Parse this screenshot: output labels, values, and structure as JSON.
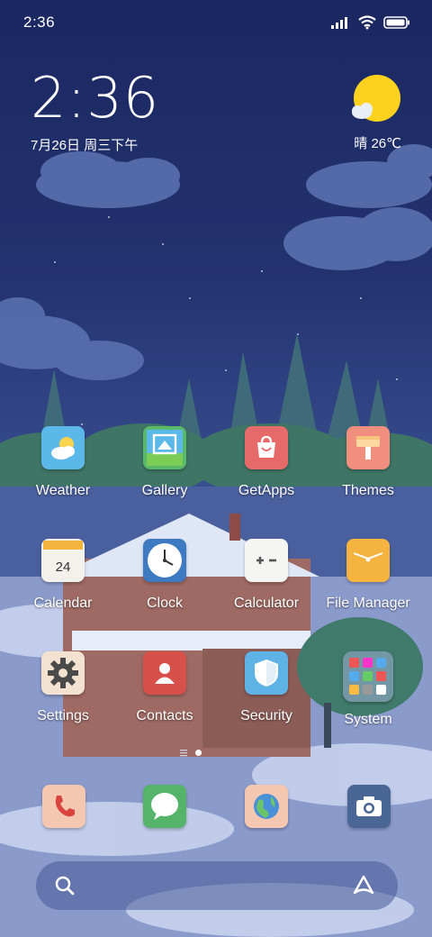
{
  "status_bar": {
    "time": "2:36",
    "icons": [
      "signal-icon",
      "wifi-icon",
      "battery-icon"
    ]
  },
  "clock_widget": {
    "time": "2:36",
    "date": "7月26日 周三下午"
  },
  "weather_widget": {
    "condition_icon": "sun-cloud-icon",
    "text": "晴 26℃"
  },
  "apps": [
    {
      "label": "Weather",
      "icon": "weather-icon"
    },
    {
      "label": "Gallery",
      "icon": "gallery-icon"
    },
    {
      "label": "GetApps",
      "icon": "getapps-icon"
    },
    {
      "label": "Themes",
      "icon": "themes-icon"
    },
    {
      "label": "Calendar",
      "icon": "calendar-icon",
      "badge": "24"
    },
    {
      "label": "Clock",
      "icon": "clock-icon"
    },
    {
      "label": "Calculator",
      "icon": "calculator-icon"
    },
    {
      "label": "File Manager",
      "icon": "folder-icon"
    },
    {
      "label": "Settings",
      "icon": "settings-icon"
    },
    {
      "label": "Contacts",
      "icon": "contacts-icon"
    },
    {
      "label": "Security",
      "icon": "security-icon"
    },
    {
      "label": "System",
      "icon": "system-folder-icon"
    }
  ],
  "page_indicator": {
    "current": 1,
    "total": 1
  },
  "dock": [
    "phone-icon",
    "messages-icon",
    "browser-icon",
    "camera-icon"
  ],
  "search_bar": {
    "left_icon": "search-icon",
    "right_icon": "assistant-icon"
  },
  "colors": {
    "sky_top": "#1b2761",
    "snow": "#98a7d2",
    "sun": "#fdd21f"
  }
}
